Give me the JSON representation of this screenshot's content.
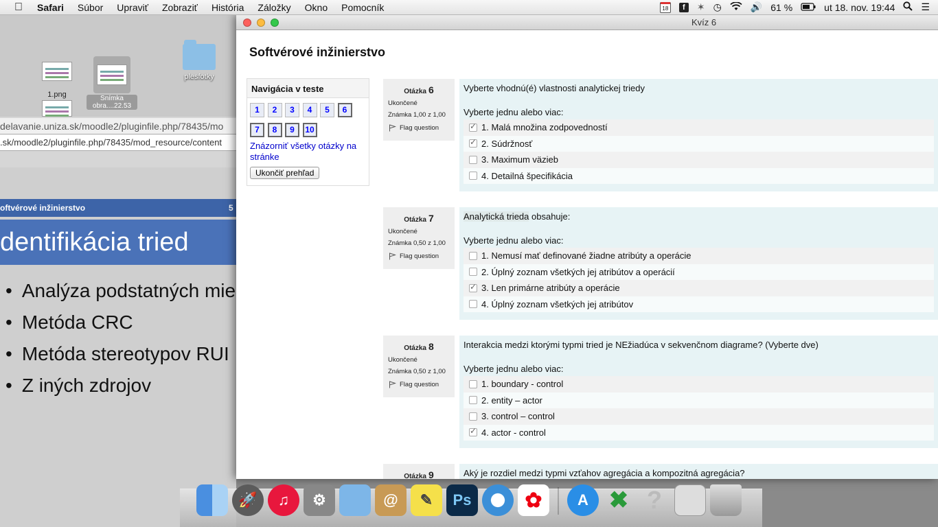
{
  "menubar": {
    "app": "Safari",
    "items": [
      "Súbor",
      "Upraviť",
      "Zobraziť",
      "História",
      "Záložky",
      "Okno",
      "Pomocník"
    ],
    "calendar_day": "18",
    "battery": "61 %",
    "datetime": "ut 18. nov.  19:44",
    "icons": [
      "apple-icon",
      "calendar-icon",
      "evernote-icon",
      "bluetooth-icon",
      "time-machine-icon",
      "wifi-icon",
      "volume-icon",
      "battery-icon",
      "search-icon",
      "list-icon"
    ]
  },
  "background": {
    "desktop_items": [
      {
        "label": "1.png"
      },
      {
        "label": "Snímka obra....22.53"
      },
      {
        "label": "plesfotky"
      }
    ],
    "url1": "delavanie.uniza.sk/moodle2/pluginfile.php/78435/mo",
    "url2": ".sk/moodle2/pluginfile.php/78435/mod_resource/content",
    "slide_header": "oftvérové inžinierstvo",
    "slide_page": "5",
    "slide_title": "dentifikácia tried",
    "slide_bullets": [
      "Analýza podstatných mie",
      "Metóda CRC",
      "Metóda stereotypov RUI",
      "Z iných zdrojov"
    ]
  },
  "window": {
    "title": "Kvíz 6",
    "course_title": "Softvérové inžinierstvo",
    "nav": {
      "heading": "Navigácia v teste",
      "buttons": [
        "1",
        "2",
        "3",
        "4",
        "5",
        "6",
        "7",
        "8",
        "9",
        "10"
      ],
      "current": "6",
      "show_all_link": "Znázorniť všetky otázky na stránke",
      "finish_button": "Ukončiť prehľad"
    },
    "questions": [
      {
        "label": "Otázka",
        "number": "6",
        "state": "Ukončené",
        "grade": "Známka 1,00 z 1,00",
        "flag": "Flag question",
        "text": "Vyberte vhodnú(é) vlastnosti analytickej triedy",
        "prompt": "Vyberte jednu alebo viac:",
        "options": [
          {
            "text": "1. Malá množina zodpovedností",
            "checked": true
          },
          {
            "text": "2. Súdržnosť",
            "checked": true
          },
          {
            "text": "3. Maximum väzieb",
            "checked": false
          },
          {
            "text": "4. Detailná špecifikácia",
            "checked": false
          }
        ]
      },
      {
        "label": "Otázka",
        "number": "7",
        "state": "Ukončené",
        "grade": "Známka 0,50 z 1,00",
        "flag": "Flag question",
        "text_highlight": "Analytická trieda",
        "text": " obsahuje:",
        "prompt": "Vyberte jednu alebo viac:",
        "options": [
          {
            "text": "1. Nemusí mať definované žiadne atribúty a operácie",
            "checked": false
          },
          {
            "text": "2. Úplný zoznam všetkých jej atribútov a operácií",
            "checked": false
          },
          {
            "text": "3. Len primárne atribúty a operácie",
            "checked": true
          },
          {
            "text": "4. Úplný zoznam všetkých jej atribútov",
            "checked": false
          }
        ]
      },
      {
        "label": "Otázka",
        "number": "8",
        "state": "Ukončené",
        "grade": "Známka 0,50 z 1,00",
        "flag": "Flag question",
        "text": "Interakcia medzi ktorými typmi tried je NEžiadúca v sekvenčnom diagrame? (Vyberte dve)",
        "prompt": "Vyberte jednu alebo viac:",
        "options": [
          {
            "text": "1. boundary - control",
            "checked": false
          },
          {
            "text": "2. entity – actor",
            "checked": false
          },
          {
            "text": "3. control – control",
            "checked": false
          },
          {
            "text": "4. actor - control",
            "checked": true
          }
        ]
      },
      {
        "label": "Otázka",
        "number": "9",
        "text": "Aký je rozdiel medzi typmi vzťahov agregácia a kompozitná agregácia?"
      }
    ]
  },
  "dock": {
    "icons": [
      "finder-icon",
      "launchpad-icon",
      "itunes-icon",
      "system-preferences-icon",
      "preview-icon",
      "contacts-icon",
      "stickies-icon",
      "photoshop-icon",
      "safari-icon",
      "acrobat-icon",
      "app-store-icon",
      "crossover-icon",
      "help-icon",
      "preview-window-icon",
      "trash-icon"
    ],
    "photoshop_label": "Ps"
  }
}
